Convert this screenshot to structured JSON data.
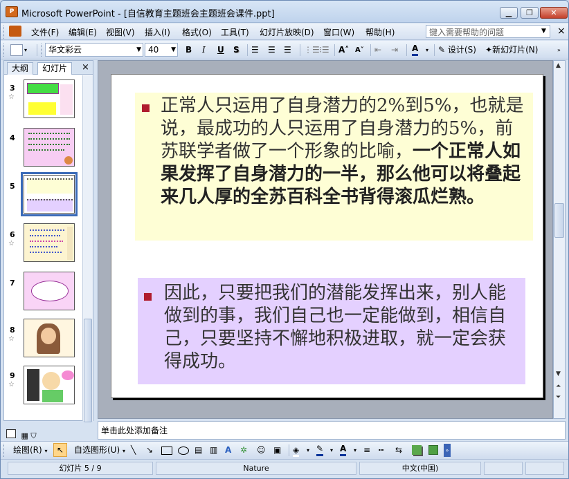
{
  "window": {
    "title": "Microsoft PowerPoint - [自信教育主题班会主题班会课件.ppt]",
    "app_icon": "P"
  },
  "menu": {
    "items": [
      "文件(F)",
      "编辑(E)",
      "视图(V)",
      "插入(I)",
      "格式(O)",
      "工具(T)",
      "幻灯片放映(D)",
      "窗口(W)",
      "帮助(H)"
    ],
    "help_placeholder": "键入需要帮助的问题"
  },
  "toolbar": {
    "font_name": "华文彩云",
    "font_size": "40",
    "bold": "B",
    "italic": "I",
    "underline": "U",
    "shadow": "S",
    "design_label": "设计(S)",
    "new_slide_label": "新幻灯片(N)"
  },
  "pane": {
    "tab_outline": "大纲",
    "tab_slides": "幻灯片",
    "close": "×",
    "slide_numbers": [
      "3",
      "4",
      "5",
      "6",
      "7",
      "8",
      "9"
    ],
    "active_slide": "5"
  },
  "slide": {
    "para1_normal": "正常人只运用了自身潜力的2%到5%，也就是说，最成功的人只运用了自身潜力的5%，前苏联学者做了一个形象的比喻，",
    "para1_bold": "一个正常人如果发挥了自身潜力的一半，那么他可以将叠起来几人厚的全苏百科全书背得滚瓜烂熟。",
    "para2": "因此，只要把我们的潜能发挥出来，别人能做到的事，我们自己也一定能做到，相信自己，只要坚持不懈地积极进取，就一定会获得成功。"
  },
  "notes": {
    "placeholder": "单击此处添加备注"
  },
  "drawing": {
    "draw_label": "绘图(R)",
    "autoshapes_label": "自选图形(U)"
  },
  "status": {
    "slide_position": "幻灯片 5 / 9",
    "design": "Nature",
    "language": "中文(中国)"
  },
  "colors": {
    "box1_bg": "#fefed5",
    "box2_bg": "#e4d0ff",
    "bullet": "#b01c2e",
    "text": "#333333"
  }
}
